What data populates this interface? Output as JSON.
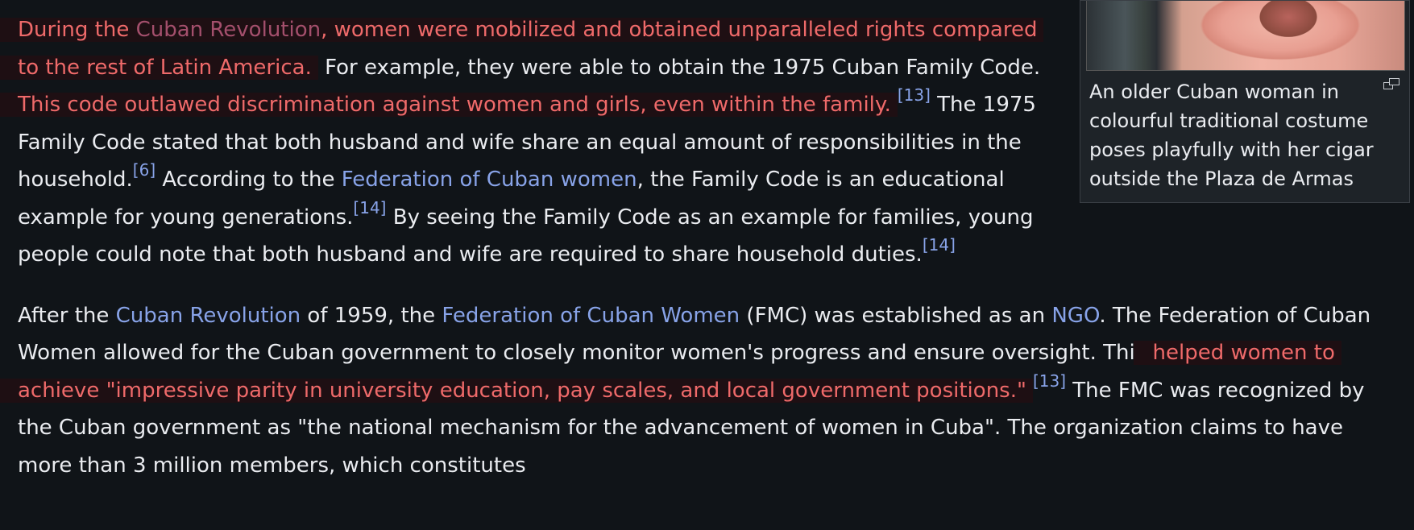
{
  "figure": {
    "image_alt": "Older Cuban woman in traditional costume",
    "caption": "An older Cuban woman in colourful traditional costume poses playfully with her cigar outside the Plaza de Armas",
    "enlarge_icon": "enlarge-icon"
  },
  "p1": {
    "s1": "During the ",
    "s1_link": "Cuban Revolution",
    "s1_end": ", women were mobilized and obtained unparalleled rights compared to the rest of Latin America.",
    "s2": " For example, they were able to obtain the 1975 Cuban Family Code. ",
    "s3": "This code outlawed discrimination against women and girls, even within the family.",
    "ref13": "[13]",
    "s4": " The 1975 Family Code stated that both husband and wife share an equal amount of responsibilities in the household.",
    "ref6": "[6]",
    "s5": " According to the ",
    "link_fcw": "Federation of Cuban women",
    "s6": ", the Family Code is an educational example for young generations.",
    "ref14a": "[14]",
    "s7": " By seeing the Family Code as an example for families, young people could note that both husband and wife are required to share household duties.",
    "ref14b": "[14]"
  },
  "p2": {
    "s1": "After the ",
    "link_rev": "Cuban Revolution",
    "s2": " of 1959, the ",
    "link_fcw": "Federation of Cuban Women",
    "s3": " (FMC) was established as an ",
    "link_ngo": "NGO",
    "s4": ". The Federation of Cuban Women allowed for the Cuban government to closely monitor women's progress and ensure oversight. This ",
    "s5": "helped women to achieve \"impressive parity in university education, pay scales, and local government positions.\"",
    "ref13": "[13]",
    "s6": " The FMC was recognized by the Cuban government as \"the national mechanism for the advancement of women in Cuba\". The organization claims to have more than 3 million members, which constitutes"
  },
  "colors": {
    "background": "#101418",
    "text": "#eaecf0",
    "link": "#88a3e8",
    "highlight_text": "#ef6a6a",
    "highlight_bg": "#1e0f13"
  }
}
